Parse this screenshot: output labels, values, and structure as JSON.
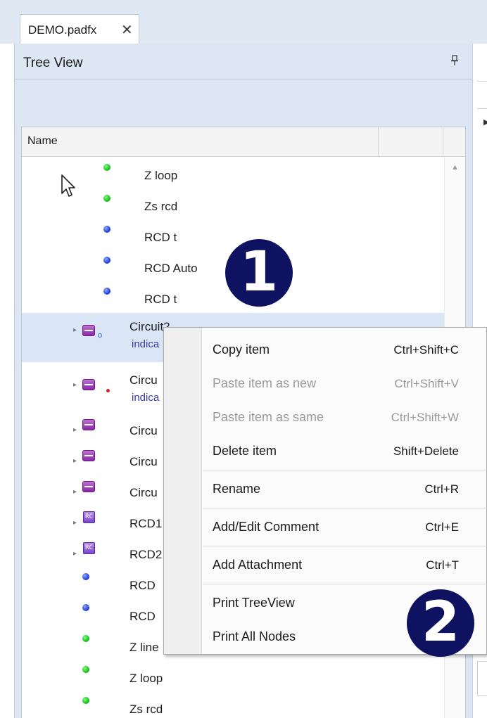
{
  "document_tab": {
    "title": "DEMO.padfx",
    "close_glyph": "✕"
  },
  "panel": {
    "title": "Tree View",
    "pin_icon": "pin-icon"
  },
  "tree": {
    "column_header": "Name",
    "items": [
      {
        "label": "Z loop",
        "icon": "green-dot"
      },
      {
        "label": "Zs rcd",
        "icon": "green-dot"
      },
      {
        "label": "RCD t",
        "icon": "blue-dot"
      },
      {
        "label": "RCD Auto",
        "icon": "blue-dot"
      },
      {
        "label": "RCD t",
        "icon": "blue-dot"
      },
      {
        "label": "Circuit2",
        "sublabel": "indica",
        "icon": "circuit-icon",
        "selected": true
      },
      {
        "label": "Circu",
        "sublabel": "indica",
        "icon": "circuit-icon"
      },
      {
        "label": "Circu",
        "icon": "circuit-icon"
      },
      {
        "label": "Circu",
        "icon": "circuit-icon"
      },
      {
        "label": "Circu",
        "icon": "circuit-icon"
      },
      {
        "label": "RCD1",
        "icon": "rcd-icon"
      },
      {
        "label": "RCD2",
        "icon": "rcd-icon"
      },
      {
        "label": "RCD",
        "icon": "blue-dot"
      },
      {
        "label": "RCD",
        "icon": "blue-dot"
      },
      {
        "label": "Z line",
        "icon": "green-dot"
      },
      {
        "label": "Z loop",
        "icon": "green-dot"
      },
      {
        "label": "Zs rcd",
        "icon": "green-dot"
      }
    ]
  },
  "context_menu": {
    "items": [
      {
        "label": "Copy item",
        "shortcut": "Ctrl+Shift+C",
        "enabled": true
      },
      {
        "label": "Paste item as new",
        "shortcut": "Ctrl+Shift+V",
        "enabled": false
      },
      {
        "label": "Paste item as same",
        "shortcut": "Ctrl+Shift+W",
        "enabled": false
      },
      {
        "label": "Delete item",
        "shortcut": "Shift+Delete",
        "enabled": true
      },
      {
        "label": "Rename",
        "shortcut": "Ctrl+R",
        "enabled": true
      },
      {
        "label": "Add/Edit Comment",
        "shortcut": "Ctrl+E",
        "enabled": true
      },
      {
        "label": "Add Attachment",
        "shortcut": "Ctrl+T",
        "enabled": true
      },
      {
        "label": "Print TreeView",
        "shortcut": "",
        "enabled": true
      },
      {
        "label": "Print All Nodes",
        "shortcut": "",
        "enabled": true
      }
    ]
  },
  "callouts": [
    "1",
    "2"
  ],
  "colors": {
    "selection": "#dae5f5",
    "callout_badge": "#0e1260",
    "status_green": "#1fbf1f",
    "status_blue": "#2442e0",
    "circuit_purple": "#8a2aa6"
  }
}
